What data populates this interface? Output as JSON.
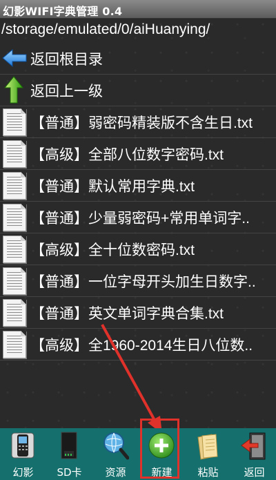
{
  "app": {
    "title": "幻影WIFI字典管理 0.4"
  },
  "path": "/storage/emulated/0/aiHuanying/",
  "nav": [
    {
      "label": "返回根目录",
      "icon": "arrow-left-icon"
    },
    {
      "label": "返回上一级",
      "icon": "arrow-up-icon"
    }
  ],
  "files": [
    {
      "label": "【普通】弱密码精装版不含生日.txt"
    },
    {
      "label": "【高级】全部八位数字密码.txt"
    },
    {
      "label": "【普通】默认常用字典.txt"
    },
    {
      "label": "【普通】少量弱密码+常用单词字.."
    },
    {
      "label": "【高级】全十位数密码.txt"
    },
    {
      "label": "【普通】一位字母开头加生日数字.."
    },
    {
      "label": "【普通】英文单词字典合集.txt"
    },
    {
      "label": "【高级】全1960-2014生日八位数.."
    }
  ],
  "toolbar": [
    {
      "label": "幻影",
      "icon": "phone-icon"
    },
    {
      "label": "SD卡",
      "icon": "sd-card-icon"
    },
    {
      "label": "资源",
      "icon": "globe-search-icon"
    },
    {
      "label": "新建",
      "icon": "plus-icon"
    },
    {
      "label": "粘贴",
      "icon": "paste-icon"
    },
    {
      "label": "返回",
      "icon": "exit-door-icon"
    }
  ],
  "colors": {
    "toolbar": "#156f6c",
    "highlight": "#e0312a",
    "new_button": "#3fae2a"
  }
}
